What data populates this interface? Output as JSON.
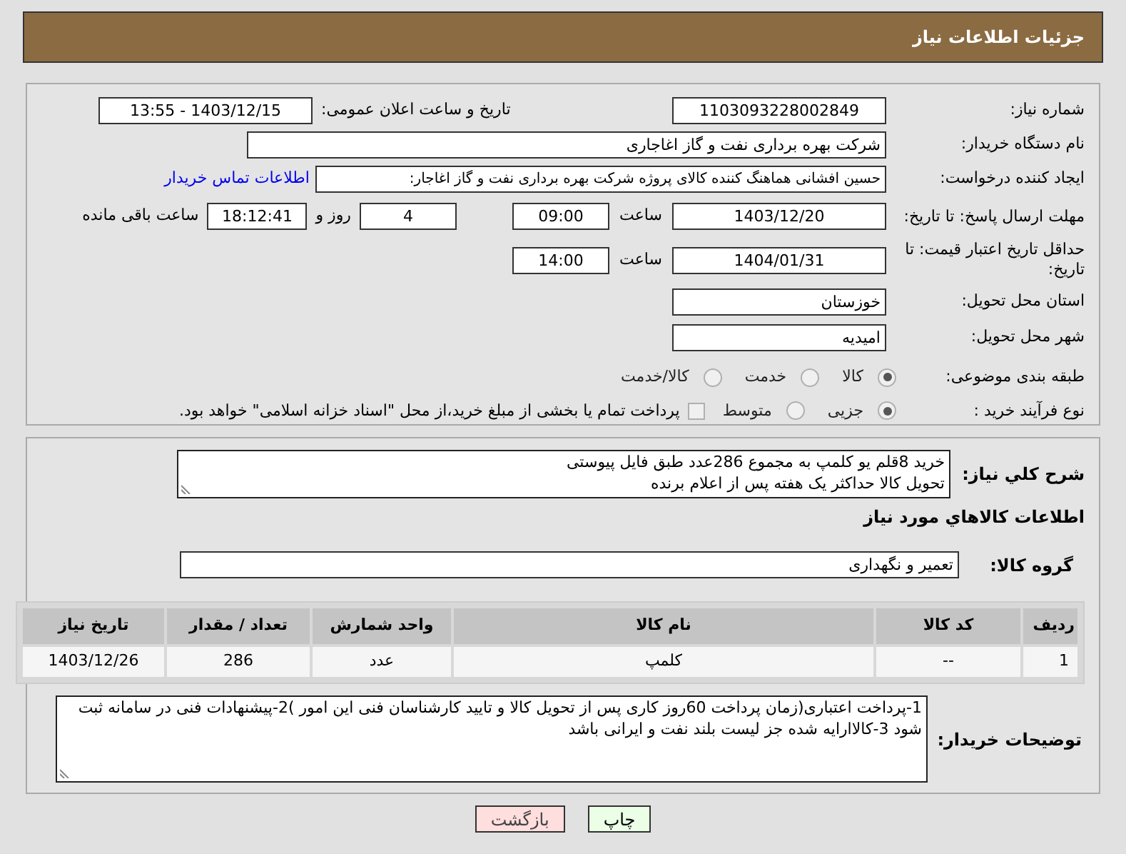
{
  "header": {
    "title": "جزئیات اطلاعات نیاز"
  },
  "need_number": {
    "label": "شماره نیاز:",
    "value": "1103093228002849"
  },
  "announce": {
    "label": "تاریخ و ساعت اعلان عمومی:",
    "value": "1403/12/15 - 13:55"
  },
  "buyer": {
    "label": "نام دستگاه خریدار:",
    "value": "شرکت بهره برداری نفت و گاز اغاجاری"
  },
  "requester": {
    "label": "ایجاد کننده درخواست:",
    "value": "حسین افشانی هماهنگ کننده کالای پروژه شرکت بهره برداری نفت و گاز اغاجار:",
    "link": "اطلاعات تماس خریدار"
  },
  "deadline": {
    "label": "مهلت ارسال پاسخ: تا تاریخ:",
    "date": "1403/12/20",
    "time_label": "ساعت",
    "time": "09:00",
    "days": "4",
    "days_label": "روز و",
    "remaining": "18:12:41",
    "remaining_label": "ساعت باقی مانده"
  },
  "validity": {
    "label": "حداقل تاریخ اعتبار قیمت: تا تاریخ:",
    "date": "1404/01/31",
    "time_label": "ساعت",
    "time": "14:00"
  },
  "province": {
    "label": "استان محل تحویل:",
    "value": "خوزستان"
  },
  "city": {
    "label": "شهر محل تحویل:",
    "value": "امیدیه"
  },
  "category": {
    "label": "طبقه بندی موضوعی:",
    "options": [
      {
        "label": "کالا",
        "selected": true
      },
      {
        "label": "خدمت",
        "selected": false
      },
      {
        "label": "کالا/خدمت",
        "selected": false
      }
    ]
  },
  "process": {
    "label": "نوع فرآیند خرید :",
    "options": [
      {
        "label": "جزیی",
        "selected": true
      },
      {
        "label": "متوسط",
        "selected": false
      }
    ],
    "treasury": {
      "label": "پرداخت تمام یا بخشی از مبلغ خرید،از محل \"اسناد خزانه اسلامی\" خواهد بود.",
      "checked": false
    }
  },
  "description": {
    "label": "شرح کلي نياز:",
    "lines": [
      "خرید 8قلم یو کلمپ به مجموع 286عدد طبق فایل پیوستی",
      "تحویل کالا حداکثر یک هفته پس از اعلام برنده"
    ]
  },
  "goods_heading": "اطلاعات کالاهاي مورد نياز",
  "goods_group": {
    "label": "گروه کالا:",
    "value": "تعمیر و نگهداری"
  },
  "table": {
    "columns": [
      "ردیف",
      "کد کالا",
      "نام کالا",
      "واحد شمارش",
      "تعداد / مقدار",
      "تاریخ نیاز"
    ],
    "rows": [
      [
        "1",
        "--",
        "کلمپ",
        "عدد",
        "286",
        "1403/12/26"
      ]
    ]
  },
  "notes": {
    "label": "توضیحات خریدار:",
    "lines": [
      "1-پرداخت اعتباری(زمان پرداخت 60روز کاری پس از تحویل کالا و تایید کارشناسان فنی این امور )2-پیشنهادات فنی در سامانه ثبت شود 3-کالاارایه شده جز لیست بلند نفت و ایرانی باشد"
    ]
  },
  "buttons": [
    {
      "kind": "print",
      "label": "چاپ"
    },
    {
      "kind": "back",
      "label": "بازگشت"
    }
  ]
}
